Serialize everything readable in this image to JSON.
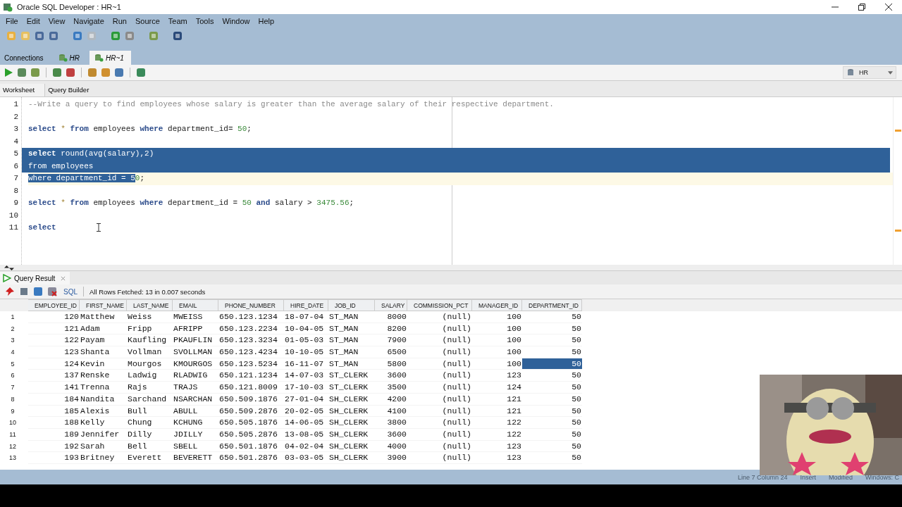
{
  "window": {
    "title": "Oracle SQL Developer : HR~1"
  },
  "menu": [
    "File",
    "Edit",
    "View",
    "Navigate",
    "Run",
    "Source",
    "Team",
    "Tools",
    "Window",
    "Help"
  ],
  "doc_tabs": [
    {
      "label": "Connections",
      "selected": false
    },
    {
      "label": "HR",
      "selected": false
    },
    {
      "label": "HR~1",
      "selected": true
    }
  ],
  "connection": "HR",
  "editor_tabs": [
    {
      "label": "Worksheet",
      "selected": true
    },
    {
      "label": "Query Builder",
      "selected": false
    }
  ],
  "code_lines": [
    {
      "num": "1",
      "current": false,
      "tokens": [
        {
          "text": "--Write a query to find employees whose salary is greater than the average salary of their respective department.",
          "kind": "comment",
          "selected": false
        }
      ]
    },
    {
      "num": "2",
      "current": false
    },
    {
      "num": "3",
      "current": false,
      "tokens": [
        {
          "text": "select",
          "kind": "kw",
          "selected": false
        },
        {
          "text": " * ",
          "kind": "op",
          "selected": false
        },
        {
          "text": "from",
          "kind": "kw",
          "selected": false
        },
        {
          "text": " employees ",
          "kind": "id",
          "selected": false
        },
        {
          "text": "where",
          "kind": "kw",
          "selected": false
        },
        {
          "text": " department_id= ",
          "kind": "id",
          "selected": false
        },
        {
          "text": "50",
          "kind": "num",
          "selected": false
        },
        {
          "text": ";",
          "kind": "id",
          "selected": false
        }
      ]
    },
    {
      "num": "4",
      "current": false
    },
    {
      "num": "5",
      "current": false,
      "tokens": [
        {
          "text": "select ",
          "kind": "kw",
          "selected": true
        },
        {
          "text": "round(avg(salary),2)",
          "kind": "id",
          "selected": true
        }
      ]
    },
    {
      "num": "6",
      "current": false,
      "tokens": [
        {
          "text": "from employees",
          "kind": "id",
          "selected": true
        }
      ]
    },
    {
      "num": "7",
      "current": true,
      "tokens": [
        {
          "text": "where department_id = 5",
          "kind": "id",
          "selected": true
        },
        {
          "text": "0",
          "kind": "num",
          "selected": false
        },
        {
          "text": ";",
          "kind": "id",
          "selected": false
        }
      ]
    },
    {
      "num": "8",
      "current": false
    },
    {
      "num": "9",
      "current": false,
      "tokens": [
        {
          "text": "select",
          "kind": "kw",
          "selected": false
        },
        {
          "text": " * ",
          "kind": "op",
          "selected": false
        },
        {
          "text": "from",
          "kind": "kw",
          "selected": false
        },
        {
          "text": " employees ",
          "kind": "id",
          "selected": false
        },
        {
          "text": "where",
          "kind": "kw",
          "selected": false
        },
        {
          "text": " department_id = ",
          "kind": "id",
          "selected": false
        },
        {
          "text": "50",
          "kind": "num",
          "selected": false
        },
        {
          "text": " and ",
          "kind": "kw",
          "selected": false
        },
        {
          "text": "salary > ",
          "kind": "id",
          "selected": false
        },
        {
          "text": "3475.56",
          "kind": "num",
          "selected": false
        },
        {
          "text": ";",
          "kind": "id",
          "selected": false
        }
      ]
    },
    {
      "num": "10",
      "current": false
    },
    {
      "num": "11",
      "current": false,
      "tokens": [
        {
          "text": "select",
          "kind": "kw",
          "selected": false
        }
      ]
    }
  ],
  "result_tab": "Query Result",
  "result_toolbar": {
    "sql_link": "SQL",
    "message": "All Rows Fetched: 13 in 0.007 seconds"
  },
  "table": {
    "columns": [
      "EMPLOYEE_ID",
      "FIRST_NAME",
      "LAST_NAME",
      "EMAIL",
      "PHONE_NUMBER",
      "HIRE_DATE",
      "JOB_ID",
      "SALARY",
      "COMMISSION_PCT",
      "MANAGER_ID",
      "DEPARTMENT_ID"
    ],
    "rows": [
      {
        "num": "1",
        "selected": false,
        "cells": [
          "120",
          "Matthew",
          "Weiss",
          "MWEISS",
          "650.123.1234",
          "18-07-04",
          "ST_MAN",
          "8000",
          "(null)",
          "100",
          "50"
        ]
      },
      {
        "num": "2",
        "selected": false,
        "cells": [
          "121",
          "Adam",
          "Fripp",
          "AFRIPP",
          "650.123.2234",
          "10-04-05",
          "ST_MAN",
          "8200",
          "(null)",
          "100",
          "50"
        ]
      },
      {
        "num": "3",
        "selected": false,
        "cells": [
          "122",
          "Payam",
          "Kaufling",
          "PKAUFLIN",
          "650.123.3234",
          "01-05-03",
          "ST_MAN",
          "7900",
          "(null)",
          "100",
          "50"
        ]
      },
      {
        "num": "4",
        "selected": false,
        "cells": [
          "123",
          "Shanta",
          "Vollman",
          "SVOLLMAN",
          "650.123.4234",
          "10-10-05",
          "ST_MAN",
          "6500",
          "(null)",
          "100",
          "50"
        ]
      },
      {
        "num": "5",
        "selected": true,
        "cells": [
          "124",
          "Kevin",
          "Mourgos",
          "KMOURGOS",
          "650.123.5234",
          "16-11-07",
          "ST_MAN",
          "5800",
          "(null)",
          "100",
          "50"
        ]
      },
      {
        "num": "6",
        "selected": false,
        "cells": [
          "137",
          "Renske",
          "Ladwig",
          "RLADWIG",
          "650.121.1234",
          "14-07-03",
          "ST_CLERK",
          "3600",
          "(null)",
          "123",
          "50"
        ]
      },
      {
        "num": "7",
        "selected": false,
        "cells": [
          "141",
          "Trenna",
          "Rajs",
          "TRAJS",
          "650.121.8009",
          "17-10-03",
          "ST_CLERK",
          "3500",
          "(null)",
          "124",
          "50"
        ]
      },
      {
        "num": "8",
        "selected": false,
        "cells": [
          "184",
          "Nandita",
          "Sarchand",
          "NSARCHAN",
          "650.509.1876",
          "27-01-04",
          "SH_CLERK",
          "4200",
          "(null)",
          "121",
          "50"
        ]
      },
      {
        "num": "9",
        "selected": false,
        "cells": [
          "185",
          "Alexis",
          "Bull",
          "ABULL",
          "650.509.2876",
          "20-02-05",
          "SH_CLERK",
          "4100",
          "(null)",
          "121",
          "50"
        ]
      },
      {
        "num": "10",
        "selected": false,
        "cells": [
          "188",
          "Kelly",
          "Chung",
          "KCHUNG",
          "650.505.1876",
          "14-06-05",
          "SH_CLERK",
          "3800",
          "(null)",
          "122",
          "50"
        ]
      },
      {
        "num": "11",
        "selected": false,
        "cells": [
          "189",
          "Jennifer",
          "Dilly",
          "JDILLY",
          "650.505.2876",
          "13-08-05",
          "SH_CLERK",
          "3600",
          "(null)",
          "122",
          "50"
        ]
      },
      {
        "num": "12",
        "selected": false,
        "cells": [
          "192",
          "Sarah",
          "Bell",
          "SBELL",
          "650.501.1876",
          "04-02-04",
          "SH_CLERK",
          "4000",
          "(null)",
          "123",
          "50"
        ]
      },
      {
        "num": "13",
        "selected": false,
        "cells": [
          "193",
          "Britney",
          "Everett",
          "BEVERETT",
          "650.501.2876",
          "03-03-05",
          "SH_CLERK",
          "3900",
          "(null)",
          "123",
          "50"
        ]
      }
    ]
  },
  "status_bar": [
    "Line 7 Column 24",
    "Insert",
    "Modified",
    "Windows: C"
  ],
  "webcam": {
    "kind": "picture"
  }
}
